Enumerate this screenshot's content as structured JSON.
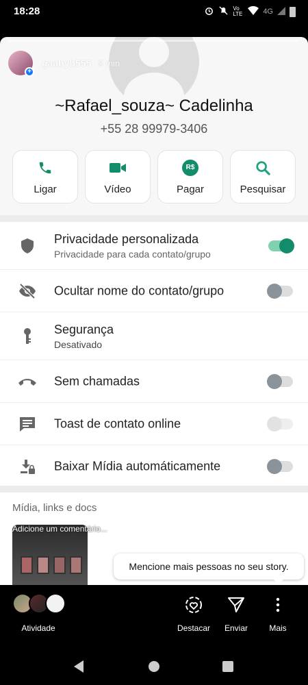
{
  "status_bar": {
    "time": "18:28",
    "network": "4G",
    "volte": "Vo LTE"
  },
  "story": {
    "username": "gaabyh555",
    "time_ago": "9 min",
    "progress": 0.0
  },
  "contact": {
    "name": "~Rafael_souza~ Cadelinha",
    "phone": "+55 28 99979-3406"
  },
  "actions": [
    {
      "label": "Ligar",
      "icon": "phone-icon"
    },
    {
      "label": "Vídeo",
      "icon": "video-icon"
    },
    {
      "label": "Pagar",
      "icon": "payment-icon",
      "badge": "R$"
    },
    {
      "label": "Pesquisar",
      "icon": "search-icon"
    }
  ],
  "settings": [
    {
      "title": "Privacidade personalizada",
      "subtitle": "Privacidade para cada contato/grupo",
      "icon": "shield-icon",
      "toggle": true,
      "state": "on"
    },
    {
      "title": "Ocultar nome do contato/grupo",
      "icon": "eye-off-icon",
      "toggle": true,
      "state": "off"
    },
    {
      "title": "Segurança",
      "subtitle": "Desativado",
      "icon": "key-icon",
      "toggle": false
    },
    {
      "title": "Sem chamadas",
      "icon": "call-end-icon",
      "toggle": true,
      "state": "off"
    },
    {
      "title": "Toast de contato online",
      "icon": "message-icon",
      "toggle": true,
      "state": "disabled"
    },
    {
      "title": "Baixar Mídia automáticamente",
      "icon": "download-lock-icon",
      "toggle": true,
      "state": "off"
    }
  ],
  "media": {
    "title": "Mídia, links e docs"
  },
  "comment_placeholder": "Adicione um comentário...",
  "tooltip": "Mencione mais pessoas no seu story.",
  "bottom_bar": {
    "activity_label": "Atividade",
    "highlight_label": "Destacar",
    "send_label": "Enviar",
    "more_label": "Mais"
  },
  "colors": {
    "accent": "#128c6a",
    "search": "#1ea37f"
  }
}
